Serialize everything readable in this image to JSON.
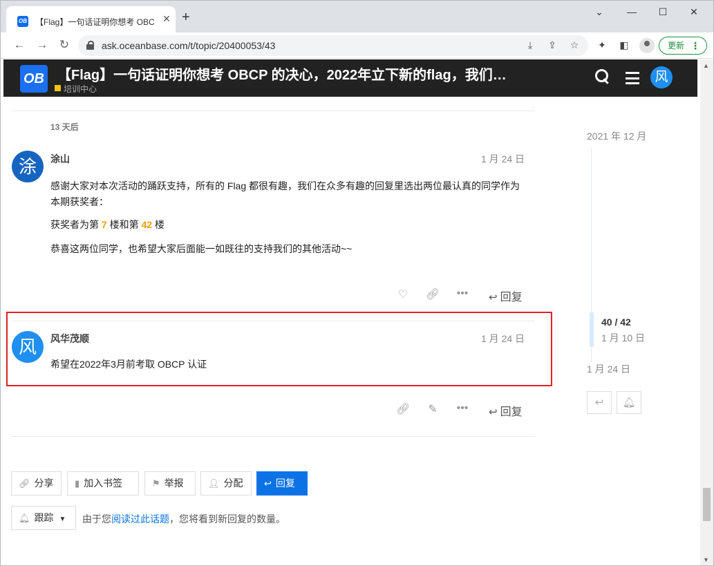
{
  "browser": {
    "tab_title": "【Flag】一句话证明你想考 OBC",
    "tab_favicon": "OB",
    "url": "ask.oceanbase.com/t/topic/20400053/43",
    "update_label": "更新"
  },
  "site": {
    "logo": "OB",
    "topic_title": "【Flag】一句话证明你想考 OBCP 的决心，2022年立下新的flag，我们…",
    "category": "培训中心",
    "user_avatar": "风"
  },
  "gap_label": "13 天后",
  "posts": [
    {
      "avatar": "涂",
      "avatar_color": "#1565c0",
      "username": "涂山",
      "date": "1 月 24 日",
      "para1": "感谢大家对本次活动的踊跃支持，所有的 Flag 都很有趣，我们在众多有趣的回复里选出两位最认真的同学作为本期获奖者：",
      "para2_pre": "获奖者为第 ",
      "para2_n1": "7",
      "para2_mid": " 楼和第 ",
      "para2_n2": "42",
      "para2_post": " 楼",
      "para3": "恭喜这两位同学，也希望大家后面能一如既往的支持我们的其他活动~~",
      "reply_label": "回复"
    },
    {
      "avatar": "风",
      "avatar_color": "#1f8ff1",
      "username": "风华茂顺",
      "date": "1 月 24 日",
      "text": "希望在2022年3月前考取 OBCP 认证",
      "reply_label": "回复"
    }
  ],
  "timeline": {
    "top_date": "2021 年 12 月",
    "position": "40 / 42",
    "position_date": "1 月 10 日",
    "bottom_date": "1 月 24 日"
  },
  "footer": {
    "share": "分享",
    "bookmark": "加入书签",
    "flag": "举报",
    "assign": "分配",
    "reply": "回复",
    "notify": "跟踪",
    "notify_pre": "由于您",
    "notify_link": "阅读过此话题",
    "notify_post": "，您将看到新回复的数量。"
  },
  "colors": {
    "accent": "#0b73e6",
    "highlight_box": "#e02020",
    "winner_number": "#e8a100"
  }
}
